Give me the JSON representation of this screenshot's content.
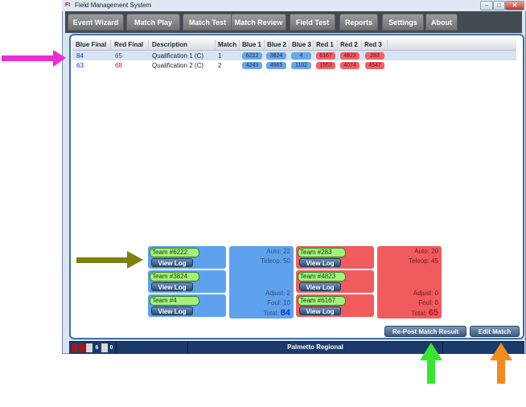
{
  "window": {
    "title": "Field Management System"
  },
  "menu": [
    "Event Wizard",
    "Match Play",
    "Match Test",
    "Match Review",
    "Field Test",
    "Reports",
    "Settings",
    "About"
  ],
  "table": {
    "columns": [
      "Blue Final",
      "Red Final",
      "Description",
      "Match",
      "Blue 1",
      "Blue 2",
      "Blue 3",
      "Red 1",
      "Red 2",
      "Red 3"
    ],
    "rows": [
      {
        "blue_final": "84",
        "red_final": "65",
        "description": "Qualification 1 (C)",
        "match": "1",
        "blue1": "6222",
        "blue2": "3824",
        "blue3": "4",
        "red1": "6167",
        "red2": "4823",
        "red3": "283",
        "selected": true
      },
      {
        "blue_final": "63",
        "red_final": "68",
        "description": "Qualification 2 (C)",
        "match": "2",
        "blue1": "4243",
        "blue2": "4965",
        "blue3": "1102",
        "red1": "1553",
        "red2": "4074",
        "red3": "4547",
        "selected": false
      }
    ]
  },
  "blue_alliance": {
    "teams": [
      "Team #6222",
      "Team #3824",
      "Team #4"
    ],
    "view_log_label": "View Log",
    "auto": "Auto: 22",
    "teleop": "Teleop: 50",
    "adjust": "Adjust: 2",
    "foul": "Foul: 10",
    "total_label": "Total:",
    "total_value": "84"
  },
  "red_alliance": {
    "teams": [
      "Team #283",
      "Team #4823",
      "Team #6167"
    ],
    "view_log_label": "View Log",
    "auto": "Auto: 20",
    "teleop": "Teleop: 45",
    "adjust": "Adjust: 0",
    "foul": "Foul: 0",
    "total_label": "Total:",
    "total_value": "65"
  },
  "buttons": {
    "repost": "Re-Post Match Result",
    "edit": "Edit Match"
  },
  "status": {
    "event_name": "Palmetto Regional",
    "count_red": "6",
    "count_gray": "0"
  },
  "colors": {
    "menubar": "#444a52",
    "blue": "#5ea2ee",
    "red": "#f25b5e",
    "status_bar": "#1b3a6c",
    "annot_magenta": "#ee2bd6",
    "annot_olive": "#7f7f12",
    "annot_green": "#37e62f",
    "annot_orange": "#f18a1f"
  }
}
